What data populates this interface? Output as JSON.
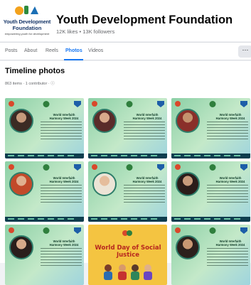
{
  "header": {
    "logo_line1": "Youth Development",
    "logo_line2": "Foundation",
    "logo_line3": "empowering youth for development",
    "page_name": "Youth Development Foundation",
    "stats": "12K likes • 13K followers"
  },
  "tabs": [
    {
      "label": "Posts",
      "active": false
    },
    {
      "label": "About",
      "active": false
    },
    {
      "label": "Reels",
      "active": false
    },
    {
      "label": "Photos",
      "active": true
    },
    {
      "label": "Videos",
      "active": false
    }
  ],
  "more_label": "···",
  "section": {
    "title": "Timeline photos",
    "meta": "863 items · 1 contributor · ⓘ"
  },
  "tiles": [
    {
      "title": "World Interfaith Harmony Week 2024"
    },
    {
      "title": "World Interfaith Harmony Week 2024"
    },
    {
      "title": "World Interfaith Harmony Week 2024"
    },
    {
      "title": "World Interfaith Harmony Week 2024"
    },
    {
      "title": "World Interfaith Harmony Week 2024"
    },
    {
      "title": "World Interfaith Harmony Week 2024"
    },
    {
      "title": "World Interfaith Harmony Week 2024"
    },
    {
      "title": "World Day of Social Justice"
    },
    {
      "title": "World Interfaith Harmony Week 2024"
    }
  ],
  "colors": {
    "accent": "#1877f2",
    "tile_green": "#8cd0a6",
    "special_yellow": "#f4c441",
    "special_red": "#b7261e"
  }
}
